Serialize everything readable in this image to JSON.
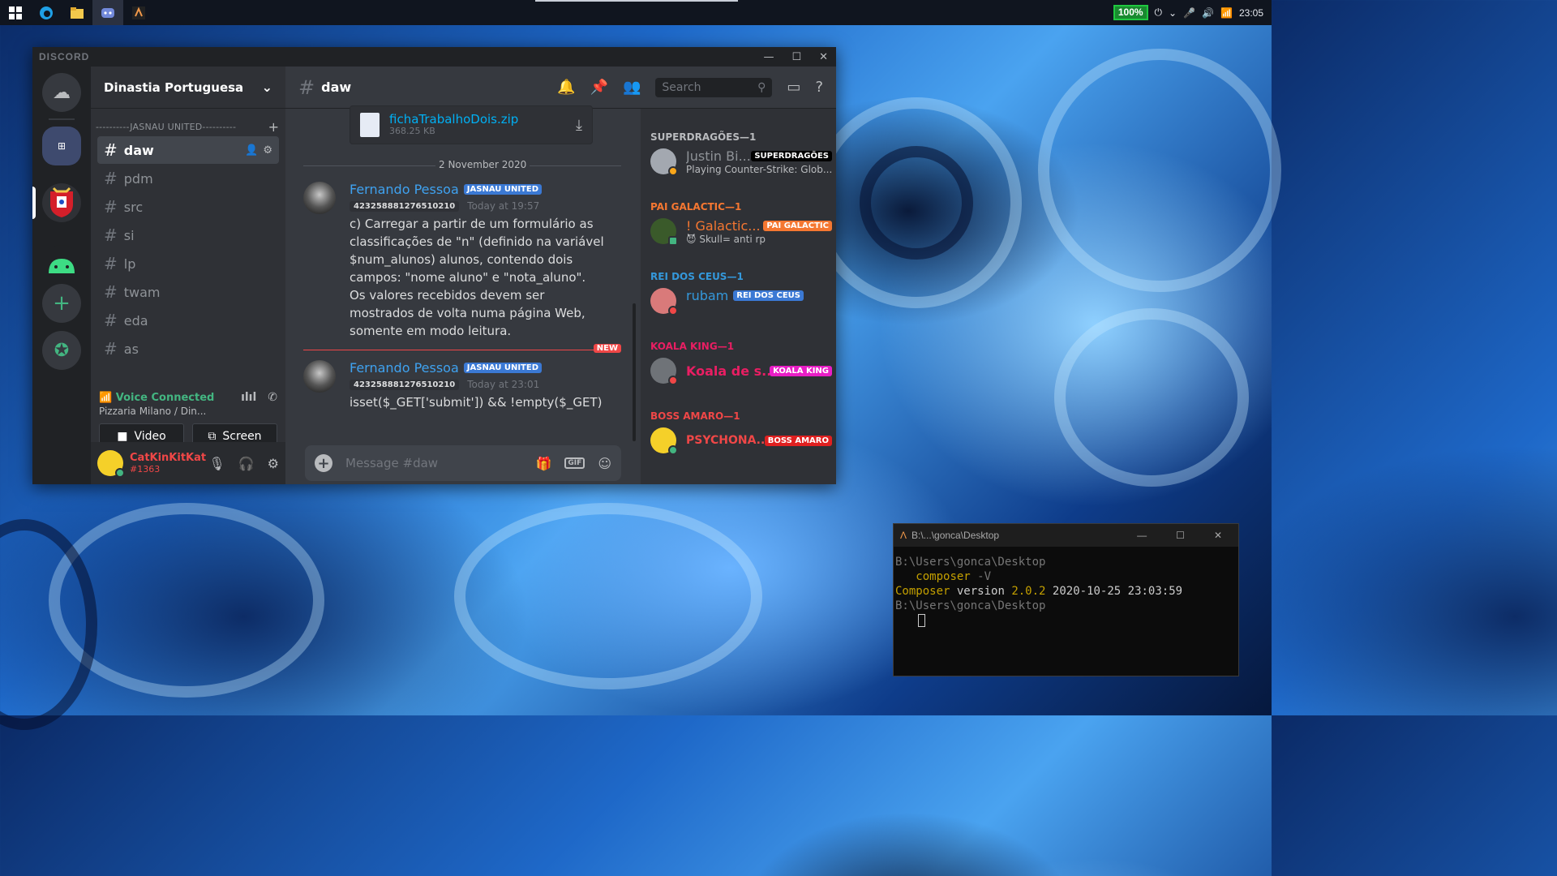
{
  "taskbar": {
    "battery": "100%",
    "time": "23:05"
  },
  "discord": {
    "logo": "DISCORD",
    "server_name": "Dinastia Portuguesa",
    "category": "----------JASNAU UNITED----------",
    "channels": [
      "daw",
      "pdm",
      "src",
      "si",
      "lp",
      "twam",
      "eda",
      "as"
    ],
    "voice": {
      "status": "Voice Connected",
      "location": "Pizzaria Milano",
      "location_suffix": "/ Din...",
      "video_label": "Video",
      "screen_label": "Screen"
    },
    "user": {
      "name": "CatKinKitKat",
      "tag": "#1363"
    },
    "header": {
      "channel": "daw",
      "search_placeholder": "Search"
    },
    "attachment": {
      "name": "fichaTrabalhoDois.zip",
      "size": "368.25 KB"
    },
    "date_divider": "2 November 2020",
    "messages": [
      {
        "author": "Fernando Pessoa",
        "role": "JASNAU UNITED",
        "id": "423258881276510210",
        "time": "Today at 19:57",
        "text": "c) Carregar a partir de um formulário as\nclassificações de \"n\" (definido na variável\n$num_alunos) alunos,  contendo dois\ncampos: \"nome aluno\" e \"nota_aluno\".\nOs valores recebidos devem ser\nmostrados de volta numa página Web,\nsomente em modo leitura."
      },
      {
        "author": "Fernando Pessoa",
        "role": "JASNAU UNITED",
        "id": "423258881276510210",
        "time": "Today at 23:01",
        "text": "isset($_GET['submit']) && !empty($_GET)"
      }
    ],
    "new_label": "NEW",
    "composer_placeholder": "Message #daw",
    "gif_label": "GIF",
    "member_groups": [
      {
        "title": "SUPERDRAGÕES—1",
        "color": "#b9bbbe",
        "member": "Justin Bi...",
        "role": "SUPERDRAGÕES",
        "role_color": "#000000",
        "name_color": "#8e9297",
        "activity": "Playing Counter-Strike: Glob..."
      },
      {
        "title": "PAI GALACTIC—1",
        "color": "#f57731",
        "member": "! Galactic...",
        "role": "PAI GALACTIC",
        "role_color": "#f57731",
        "name_color": "#f57731",
        "activity": "Skull= anti rp"
      },
      {
        "title": "REI DOS CEUS—1",
        "color": "#3498db",
        "member": "rubam",
        "role": "REI DOS CEUS",
        "role_color": "#3b79d4",
        "name_color": "#3498db",
        "activity": ""
      },
      {
        "title": "KOALA KING—1",
        "color": "#e91e63",
        "member": "Koala de s...",
        "role": "KOALA KING",
        "role_color": "#e91ec6",
        "name_color": "#e91e63",
        "activity": ""
      },
      {
        "title": "BOSS AMARO—1",
        "color": "#f04747",
        "member": "PSYCHONA...",
        "role": "BOSS AMARO",
        "role_color": "#e02020",
        "name_color": "#f04747",
        "activity": ""
      }
    ]
  },
  "terminal": {
    "title": "B:\\...\\gonca\\Desktop",
    "line1": "B:\\Users\\gonca\\Desktop",
    "cmd": "composer",
    "flag": "-V",
    "out_prefix": "Composer",
    "out_word": "version",
    "out_version": "2.0.2",
    "out_date": "2020-10-25 23:03:59",
    "line4": "B:\\Users\\gonca\\Desktop"
  }
}
